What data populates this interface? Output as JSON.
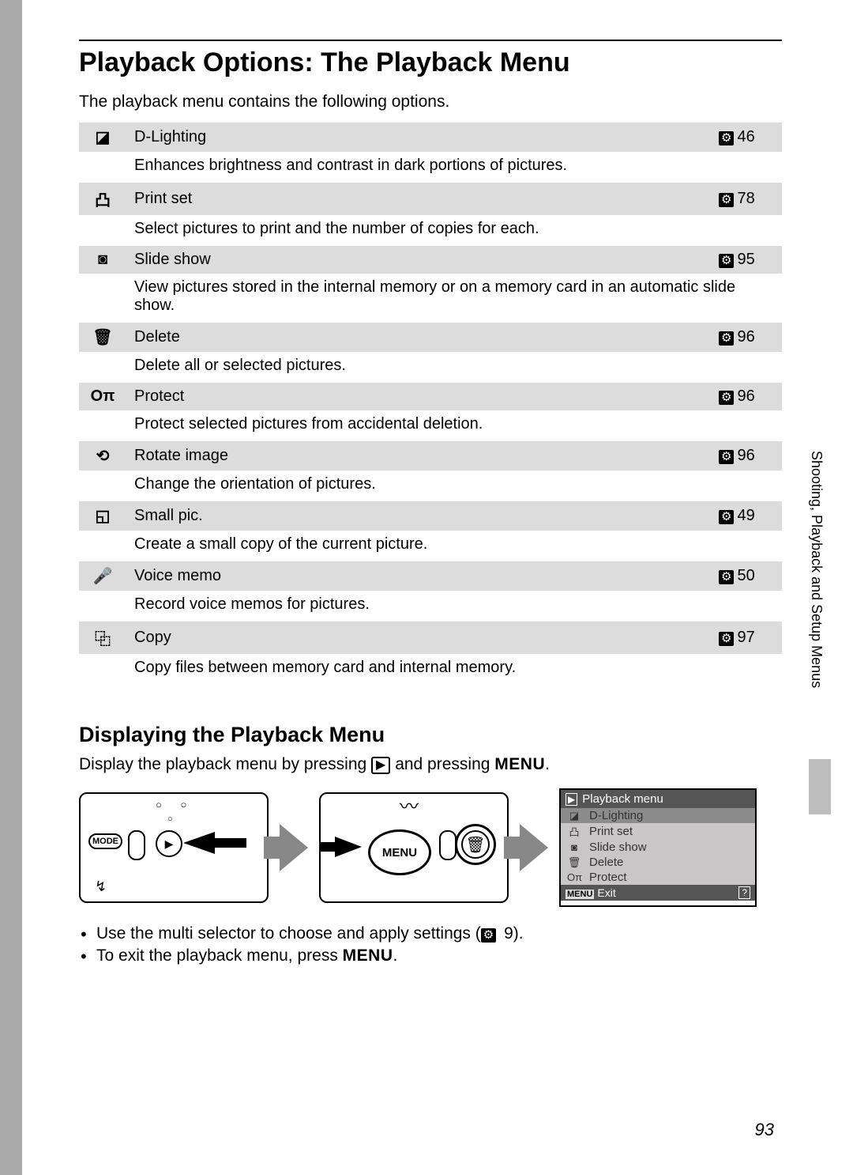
{
  "page_title": "Playback Options: The Playback Menu",
  "intro": "The playback menu contains the following options.",
  "ref_symbol": "⚙",
  "menu_items": [
    {
      "icon": "◪",
      "name": "D-Lighting",
      "page": "46",
      "desc": "Enhances brightness and contrast in dark portions of pictures."
    },
    {
      "icon": "凸",
      "name": "Print set",
      "page": "78",
      "desc": "Select pictures to print and the number of copies for each."
    },
    {
      "icon": "◙",
      "name": "Slide show",
      "page": "95",
      "desc": "View pictures stored in the internal memory or on a memory card in an automatic slide show."
    },
    {
      "icon": "🗑",
      "name": "Delete",
      "page": "96",
      "desc": "Delete all or selected pictures."
    },
    {
      "icon": "Oπ",
      "name": "Protect",
      "page": "96",
      "desc": "Protect selected pictures from accidental deletion."
    },
    {
      "icon": "⟲",
      "name": "Rotate image",
      "page": "96",
      "desc": "Change the orientation of pictures."
    },
    {
      "icon": "◱",
      "name": "Small pic.",
      "page": "49",
      "desc": "Create a small copy of the current picture."
    },
    {
      "icon": "🎤",
      "name": "Voice memo",
      "page": "50",
      "desc": "Record voice memos for pictures."
    },
    {
      "icon": "⿻",
      "name": "Copy",
      "page": "97",
      "desc": "Copy files between memory card and internal memory."
    }
  ],
  "section2_title": "Displaying the Playback Menu",
  "section2_text_pre": "Display the playback menu by pressing ",
  "playback_icon": "▶",
  "section2_text_mid": " and pressing ",
  "menu_word": "MENU",
  "section2_text_post": ".",
  "screen": {
    "title": "Playback menu",
    "items": [
      {
        "icon": "◪",
        "label": "D-Lighting",
        "selected": true
      },
      {
        "icon": "凸",
        "label": "Print set",
        "selected": false
      },
      {
        "icon": "◙",
        "label": "Slide show",
        "selected": false
      },
      {
        "icon": "🗑",
        "label": "Delete",
        "selected": false
      },
      {
        "icon": "Oπ",
        "label": "Protect",
        "selected": false
      }
    ],
    "footer_menu": "MENU",
    "footer_exit": "Exit",
    "footer_help": "?"
  },
  "bullets": {
    "b1_pre": "Use the multi selector to choose and apply settings (",
    "b1_page": "9",
    "b1_post": ").",
    "b2_pre": "To exit the playback menu, press ",
    "b2_post": "."
  },
  "side_label": "Shooting, Playback and Setup Menus",
  "page_number": "93",
  "camera1": {
    "mode": "MODE",
    "flash": "↯"
  },
  "camera2": {
    "menu": "MENU",
    "trash": "🗑"
  }
}
